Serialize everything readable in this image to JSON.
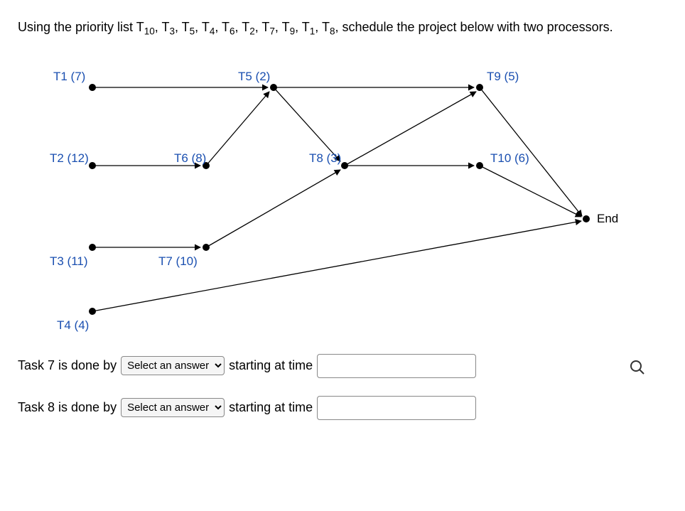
{
  "question": {
    "pre": "Using the priority list ",
    "list_html": "T<sub>10</sub>, T<sub>3</sub>, T<sub>5</sub>, T<sub>4</sub>, T<sub>6</sub>, T<sub>2</sub>, T<sub>7</sub>, T<sub>9</sub>, T<sub>1</sub>, T<sub>8</sub>",
    "post": ", schedule the project below with two processors."
  },
  "nodes": {
    "t1": "T1 (7)",
    "t2": "T2 (12)",
    "t3": "T3 (11)",
    "t4": "T4 (4)",
    "t5": "T5 (2)",
    "t6": "T6 (8)",
    "t7": "T7 (10)",
    "t8": "T8 (3)",
    "t9": "T9 (5)",
    "t10": "T10 (6)",
    "end": "End"
  },
  "answers": {
    "row7_label": "Task 7 is done by",
    "row8_label": "Task 8 is done by",
    "select_placeholder": "Select an answer",
    "starting": "starting at time"
  }
}
